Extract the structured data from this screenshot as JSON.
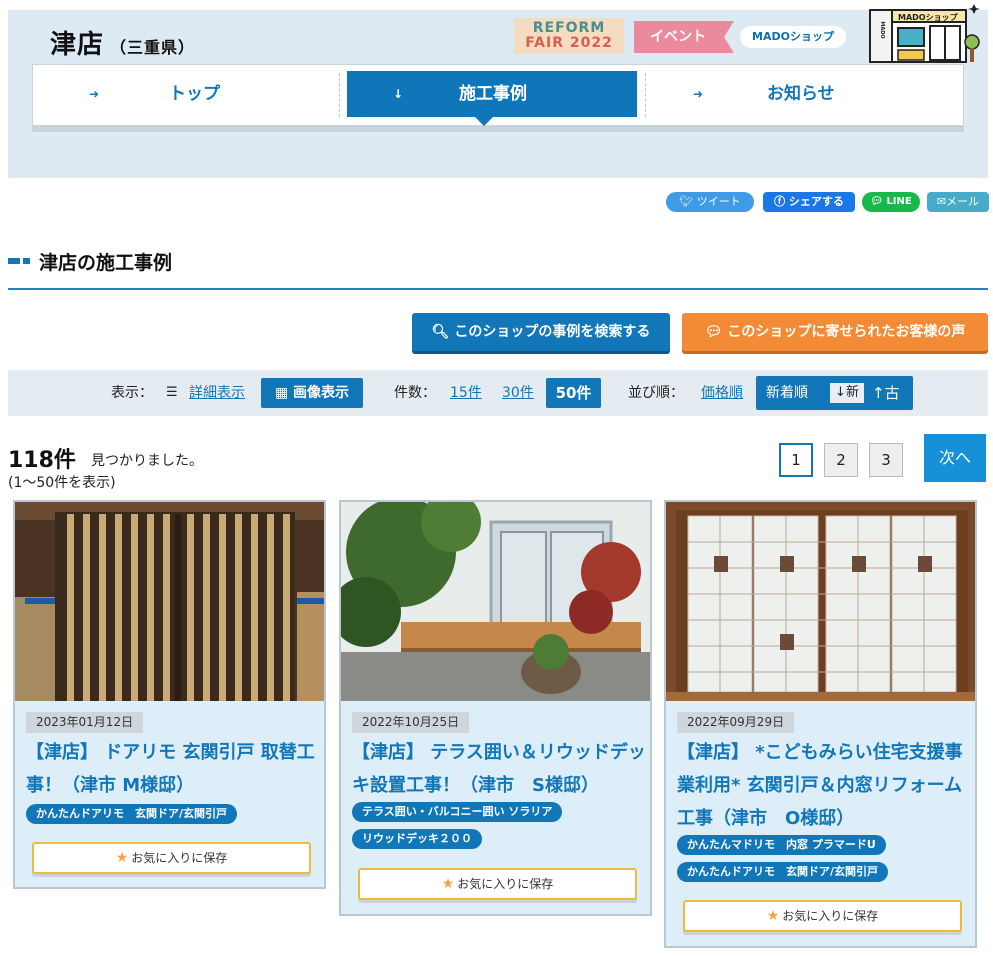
{
  "header": {
    "shop_name": "津店",
    "prefecture": "（三重県）",
    "reform_line1": "REFORM",
    "reform_line2": "FAIR 2022",
    "event_label": "イベント",
    "mado_label": "MADOショップ",
    "illust_sign": "MADOショップ",
    "illust_side": "MADO"
  },
  "nav": {
    "top": "トップ",
    "cases": "施工事例",
    "news": "お知らせ"
  },
  "share": {
    "tweet": "ツイート",
    "facebook": "シェアする",
    "line": "LINE",
    "mail": "メール"
  },
  "section_title": "津店の施工事例",
  "actions": {
    "search": "このショップの事例を検索する",
    "voice": "このショップに寄せられたお客様の声"
  },
  "filter": {
    "display_label": "表示：",
    "detail_view": "詳細表示",
    "image_view": "画像表示",
    "count_label": "件数：",
    "count_15": "15件",
    "count_30": "30件",
    "count_50": "50件",
    "sort_label": "並び順：",
    "sort_price": "価格順",
    "sort_new": "新着順",
    "sort_desc": "↓新",
    "sort_asc": "↑古"
  },
  "results": {
    "total": "118件",
    "found_text": "見つかりました。",
    "range_text": "(1～50件を表示)",
    "pages": [
      "1",
      "2",
      "3"
    ],
    "next": "次へ"
  },
  "cards": [
    {
      "date": "2023年01月12日",
      "title": "【津店】 ドアリモ 玄関引戸 取替工事！（津市 M様邸）",
      "tags": [
        "かんたんドアリモ　玄関ドア/玄関引戸"
      ],
      "fav": "お気に入りに保存"
    },
    {
      "date": "2022年10月25日",
      "title": "【津店】 テラス囲い＆リウッドデッキ設置工事！（津市　S様邸）",
      "tags": [
        "テラス囲い・バルコニー囲い ソラリア",
        "リウッドデッキ２００"
      ],
      "fav": "お気に入りに保存"
    },
    {
      "date": "2022年09月29日",
      "title": "【津店】 *こどもみらい住宅支援事業利用* 玄関引戸＆内窓リフォーム工事（津市　O様邸）",
      "tags": [
        "かんたんマドリモ　内窓 プラマードU",
        "かんたんドアリモ　玄関ドア/玄関引戸"
      ],
      "fav": "お気に入りに保存"
    }
  ],
  "colors": {
    "brand_blue": "#1277b8",
    "header_bg": "#dde9f3",
    "orange": "#f28a36",
    "card_bg": "#deeef8"
  }
}
